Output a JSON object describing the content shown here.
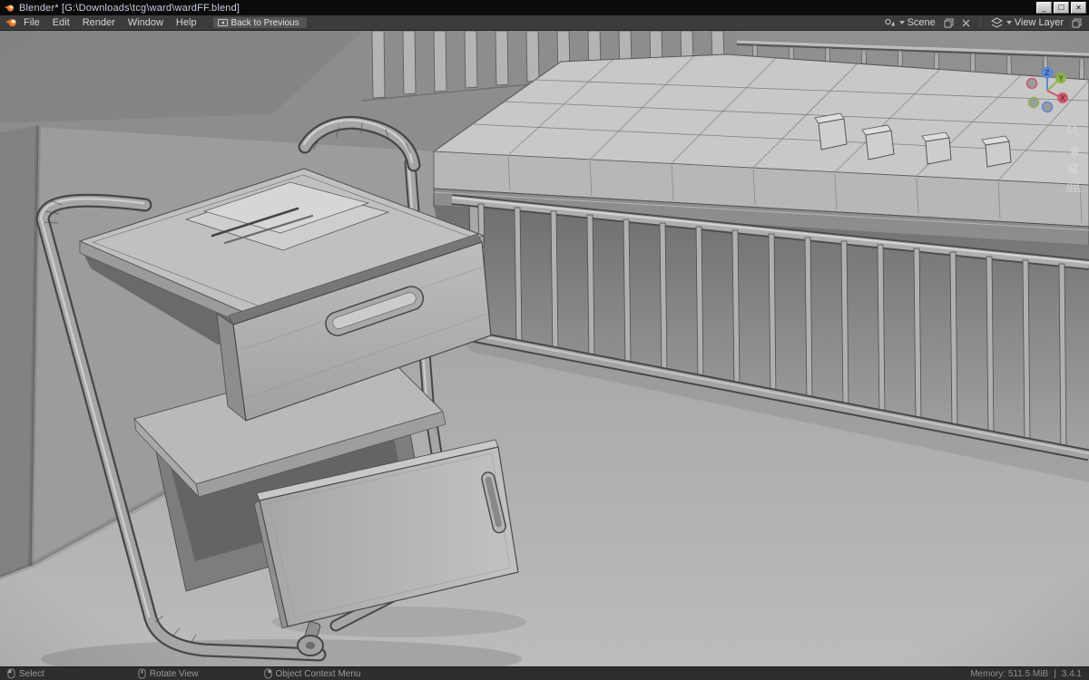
{
  "window": {
    "title": "Blender* [G:\\Downloads\\tcg\\ward\\wardFF.blend]",
    "controls": {
      "minimize": "_",
      "maximize": "☐",
      "close": "✕"
    }
  },
  "menubar": {
    "menus": [
      "File",
      "Edit",
      "Render",
      "Window",
      "Help"
    ],
    "back_button": "Back to Previous",
    "scene_label": "Scene",
    "view_layer_label": "View Layer"
  },
  "gizmo": {
    "x": "X",
    "y": "Y",
    "z": "Z"
  },
  "viewport": {
    "tool_icons": [
      "zoom-icon",
      "pan-hand-icon",
      "camera-view-icon",
      "grid-ortho-icon"
    ],
    "scene_objects": [
      "hospital-bed",
      "bedside-cart",
      "wall",
      "floor"
    ]
  },
  "statusbar": {
    "hints": [
      "Select",
      "Rotate View",
      "Object Context Menu"
    ],
    "memory": "Memory: 511.5 MiB",
    "divider": "|",
    "version": "3.4.1"
  },
  "colors": {
    "titlebar_bg": "#0b0b0b",
    "topbar_bg": "#3c3c3c",
    "statusbar_bg": "#2d2d2d",
    "viewport_wall": "#9c9c9c",
    "viewport_floor": "#b2b2b2",
    "axis_x": "#cd5a6e",
    "axis_y": "#8fb34d",
    "axis_z": "#5f87d4",
    "blender_orange": "#f5792a"
  }
}
